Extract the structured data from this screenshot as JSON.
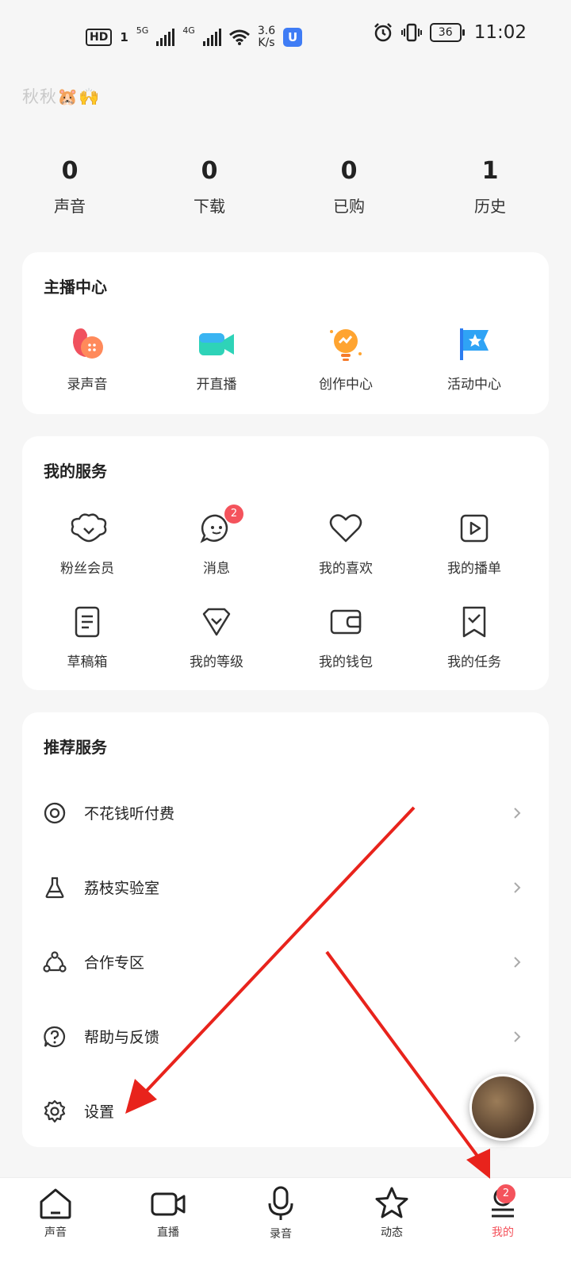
{
  "status_bar": {
    "hd": "HD",
    "sim1": "1",
    "net1": "5G",
    "net2": "4G",
    "speed_value": "3.6",
    "speed_unit": "K/s",
    "battery": "36",
    "time": "11:02",
    "icons": [
      "hd-icon",
      "signal-icon",
      "wifi-icon",
      "app-notification-icon",
      "alarm-icon",
      "vibrate-icon",
      "battery-icon"
    ]
  },
  "profile": {
    "username": "秋秋🐹🙌"
  },
  "stats": [
    {
      "value": "0",
      "label": "声音"
    },
    {
      "value": "0",
      "label": "下载"
    },
    {
      "value": "0",
      "label": "已购"
    },
    {
      "value": "1",
      "label": "历史"
    }
  ],
  "anchor_center": {
    "title": "主播中心",
    "items": [
      {
        "label": "录声音",
        "icon": "record-voice-icon"
      },
      {
        "label": "开直播",
        "icon": "live-camera-icon"
      },
      {
        "label": "创作中心",
        "icon": "lightbulb-icon"
      },
      {
        "label": "活动中心",
        "icon": "star-flag-icon"
      }
    ]
  },
  "my_services": {
    "title": "我的服务",
    "items": [
      {
        "label": "粉丝会员",
        "icon": "fan-cloud-icon"
      },
      {
        "label": "消息",
        "icon": "message-icon",
        "badge": "2"
      },
      {
        "label": "我的喜欢",
        "icon": "heart-icon"
      },
      {
        "label": "我的播单",
        "icon": "playlist-icon"
      },
      {
        "label": "草稿箱",
        "icon": "draft-icon"
      },
      {
        "label": "我的等级",
        "icon": "level-diamond-icon"
      },
      {
        "label": "我的钱包",
        "icon": "wallet-icon"
      },
      {
        "label": "我的任务",
        "icon": "task-icon"
      }
    ]
  },
  "recommended": {
    "title": "推荐服务",
    "items": [
      {
        "label": "不花钱听付费",
        "icon": "free-listen-icon"
      },
      {
        "label": "荔枝实验室",
        "icon": "flask-icon"
      },
      {
        "label": "合作专区",
        "icon": "cooperation-icon"
      },
      {
        "label": "帮助与反馈",
        "icon": "help-icon"
      },
      {
        "label": "设置",
        "icon": "gear-icon"
      }
    ]
  },
  "tabbar": {
    "items": [
      {
        "label": "声音",
        "icon": "home-icon"
      },
      {
        "label": "直播",
        "icon": "video-icon"
      },
      {
        "label": "录音",
        "icon": "microphone-icon"
      },
      {
        "label": "动态",
        "icon": "star-icon"
      },
      {
        "label": "我的",
        "icon": "profile-icon",
        "badge": "2",
        "active": true
      }
    ]
  },
  "colors": {
    "accent": "#f4535c",
    "background": "#f6f6f6",
    "card": "#ffffff",
    "annotation_arrow": "#e8231c"
  }
}
